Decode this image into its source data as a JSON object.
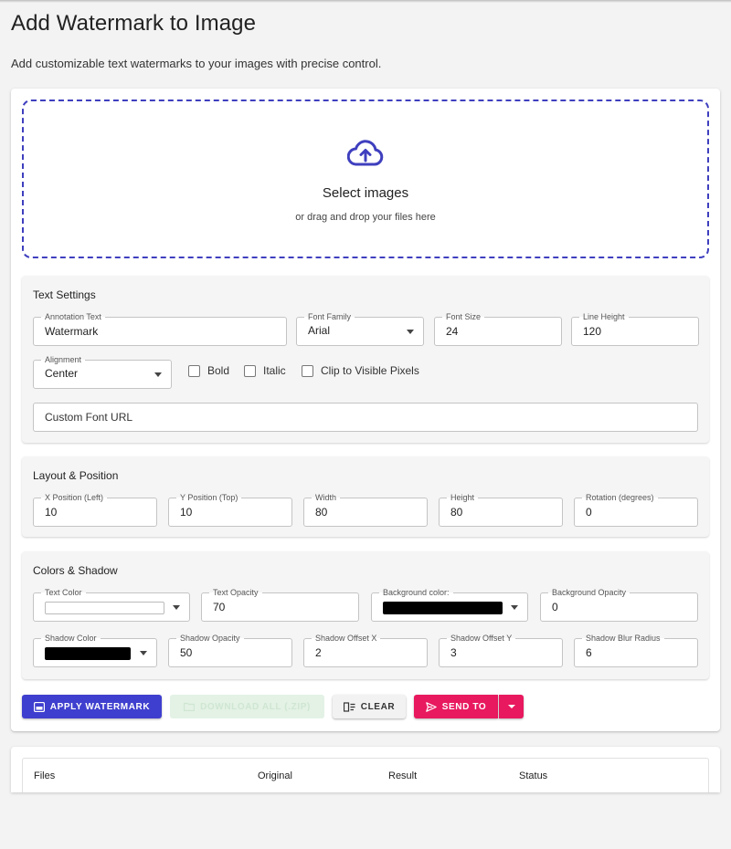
{
  "page": {
    "title": "Add Watermark to Image",
    "description": "Add customizable text watermarks to your images with precise control."
  },
  "dropzone": {
    "title": "Select images",
    "subtitle": "or drag and drop your files here",
    "icon": "cloud-upload-icon"
  },
  "text_settings": {
    "title": "Text Settings",
    "annotation_text": {
      "label": "Annotation Text",
      "value": "Watermark"
    },
    "font_family": {
      "label": "Font Family",
      "value": "Arial"
    },
    "font_size": {
      "label": "Font Size",
      "value": "24"
    },
    "line_height": {
      "label": "Line Height",
      "value": "120"
    },
    "alignment": {
      "label": "Alignment",
      "value": "Center"
    },
    "bold": "Bold",
    "italic": "Italic",
    "clip": "Clip to Visible Pixels",
    "custom_font_url": {
      "placeholder": "Custom Font URL"
    }
  },
  "layout": {
    "title": "Layout & Position",
    "x_position": {
      "label": "X Position (Left)",
      "value": "10"
    },
    "y_position": {
      "label": "Y Position (Top)",
      "value": "10"
    },
    "width": {
      "label": "Width",
      "value": "80"
    },
    "height": {
      "label": "Height",
      "value": "80"
    },
    "rotation": {
      "label": "Rotation (degrees)",
      "value": "0"
    }
  },
  "colors": {
    "title": "Colors & Shadow",
    "text_color": {
      "label": "Text Color",
      "color": "#ffffff"
    },
    "text_opacity": {
      "label": "Text Opacity",
      "value": "70"
    },
    "background_color": {
      "label": "Background color:",
      "color": "#000000"
    },
    "background_opacity": {
      "label": "Background Opacity",
      "value": "0"
    },
    "shadow_color": {
      "label": "Shadow Color",
      "color": "#000000"
    },
    "shadow_opacity": {
      "label": "Shadow Opacity",
      "value": "50"
    },
    "shadow_offset_x": {
      "label": "Shadow Offset X",
      "value": "2"
    },
    "shadow_offset_y": {
      "label": "Shadow Offset Y",
      "value": "3"
    },
    "shadow_blur": {
      "label": "Shadow Blur Radius",
      "value": "6"
    }
  },
  "actions": {
    "apply": "Apply Watermark",
    "download": "Download All (.zip)",
    "clear": "Clear",
    "send_to": "Send To"
  },
  "results": {
    "columns": [
      "Files",
      "Original",
      "Result",
      "Status"
    ]
  },
  "theme": {
    "primary": "#3f3fcf",
    "accent": "#e8195e",
    "dropzone_border": "#3f3fbf"
  }
}
